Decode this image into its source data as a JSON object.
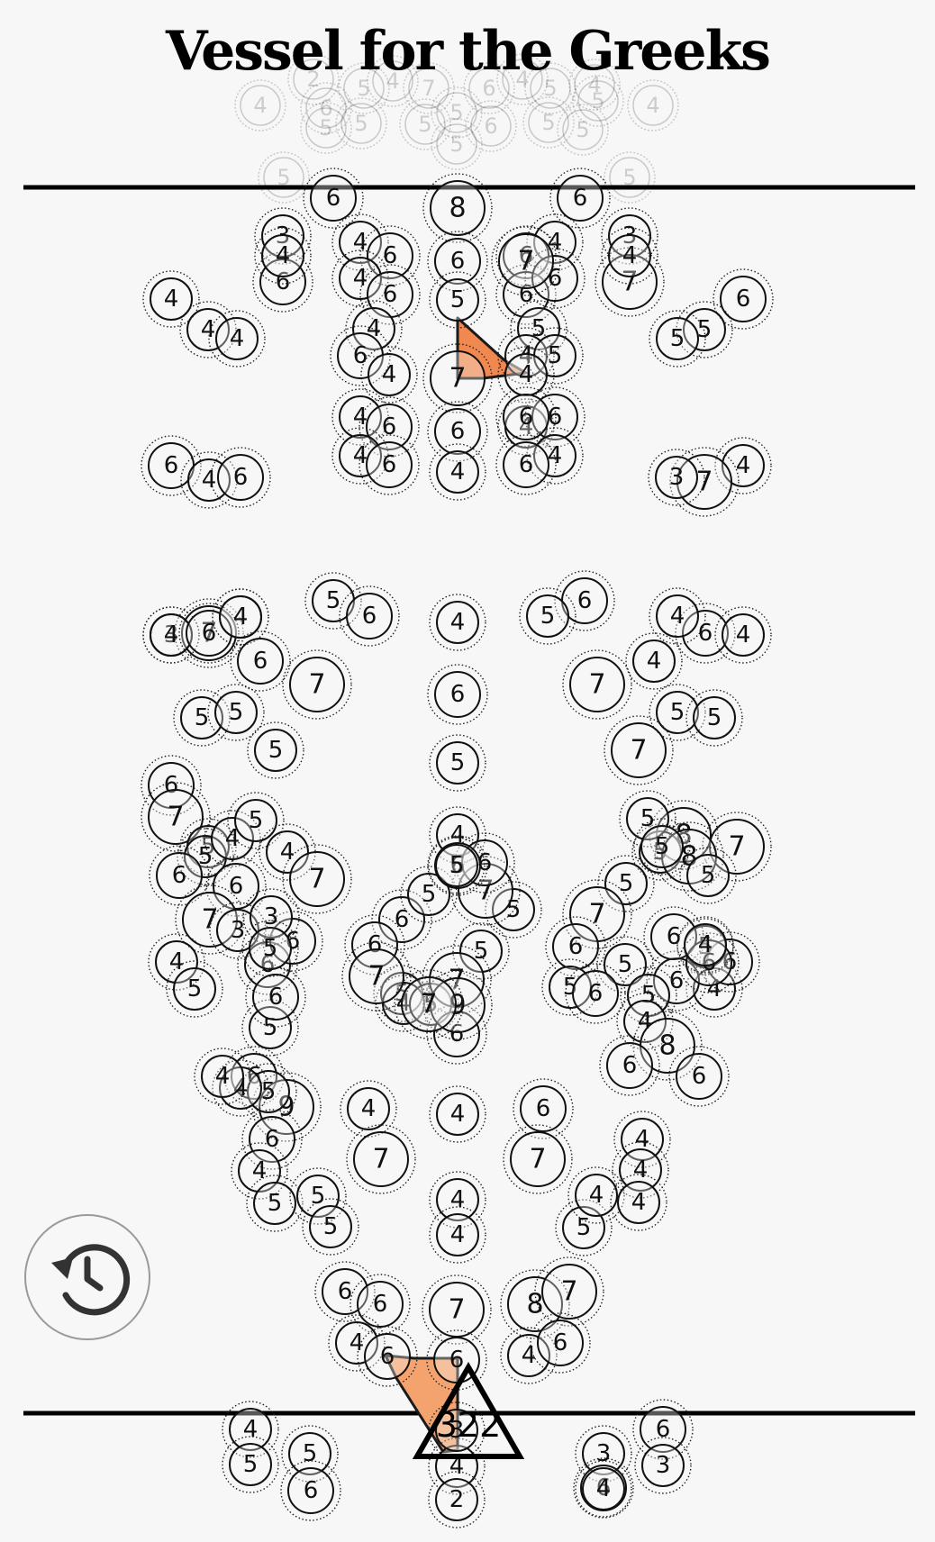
{
  "title": "Vessel for the Greeks",
  "counter": "322",
  "colors": {
    "highlight": "#f0884f",
    "highlight_light": "#f5a36e",
    "line": "#000000",
    "background": "#f7f7f7"
  },
  "icons": {
    "history": "history-icon",
    "counter": "triangle-icon"
  },
  "ghost_numbers": [
    "4",
    "6",
    "5",
    "5",
    "2",
    "5",
    "5",
    "7",
    "6",
    "5",
    "4",
    "4",
    "5",
    "5",
    "5",
    "6",
    "5",
    "5",
    "5",
    "5",
    "4",
    "4"
  ],
  "number_circles": [
    "6",
    "8",
    "6",
    "3",
    "4",
    "6",
    "3",
    "4",
    "6",
    "6",
    "4",
    "6",
    "6",
    "4",
    "7",
    "6",
    "6",
    "7",
    "4",
    "4",
    "6",
    "4",
    "4",
    "5",
    "5",
    "4",
    "5",
    "5",
    "6",
    "4",
    "7",
    "4",
    "5",
    "4",
    "4",
    "6",
    "6",
    "4",
    "6",
    "6",
    "4",
    "6",
    "4",
    "4",
    "6",
    "6",
    "4",
    "6",
    "4",
    "7",
    "3",
    "3",
    "7",
    "4",
    "5",
    "6",
    "4",
    "6",
    "5",
    "4",
    "6",
    "4",
    "6",
    "4",
    "4",
    "6",
    "4",
    "5",
    "5",
    "7",
    "6",
    "7",
    "5",
    "5",
    "5",
    "5",
    "7",
    "6",
    "7",
    "5",
    "5",
    "4",
    "5",
    "4",
    "7",
    "6",
    "6",
    "7",
    "3",
    "4",
    "5",
    "6",
    "6",
    "3",
    "5",
    "6",
    "5",
    "8",
    "5",
    "5",
    "7",
    "8",
    "5",
    "5",
    "4",
    "6",
    "5",
    "6",
    "6",
    "5",
    "7",
    "6",
    "5",
    "5",
    "6",
    "5",
    "6",
    "4",
    "5",
    "5",
    "7",
    "4",
    "6",
    "6",
    "5",
    "6",
    "6",
    "5",
    "5",
    "4",
    "7",
    "5",
    "7",
    "6",
    "9",
    "7",
    "4",
    "8",
    "6",
    "6",
    "6",
    "9",
    "5",
    "4",
    "4",
    "4",
    "4",
    "6",
    "6",
    "4",
    "4",
    "7",
    "7",
    "4",
    "5",
    "5",
    "5",
    "5",
    "4",
    "4",
    "4",
    "4",
    "6",
    "6",
    "7",
    "8",
    "7",
    "4",
    "6",
    "4",
    "6",
    "6",
    "4",
    "5",
    "5",
    "6",
    "4",
    "2",
    "3",
    "6",
    "6",
    "3",
    "3",
    "4",
    "6",
    "3",
    "6",
    "3",
    "4"
  ]
}
